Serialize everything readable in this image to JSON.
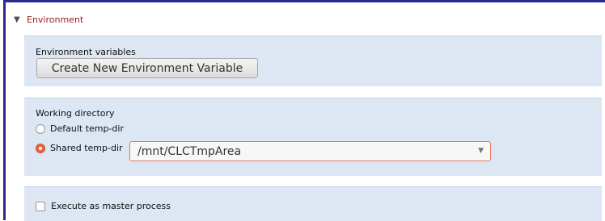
{
  "header": {
    "title": "Environment"
  },
  "environment": {
    "label": "Environment variables",
    "create_button_label": "Create New Environment Variable"
  },
  "working_directory": {
    "label": "Working directory",
    "options": [
      {
        "label": "Default temp-dir",
        "selected": false
      },
      {
        "label": "Shared temp-dir",
        "selected": true
      }
    ],
    "shared_dir_value": "/mnt/CLCTmpArea"
  },
  "execution": {
    "master_process_label": "Execute as master process",
    "master_process_checked": false
  },
  "colors": {
    "frame_border": "#2b2a8c",
    "header_text": "#9c1a1a",
    "section_background": "#dde6f3",
    "radio_selected": "#e9633f"
  }
}
